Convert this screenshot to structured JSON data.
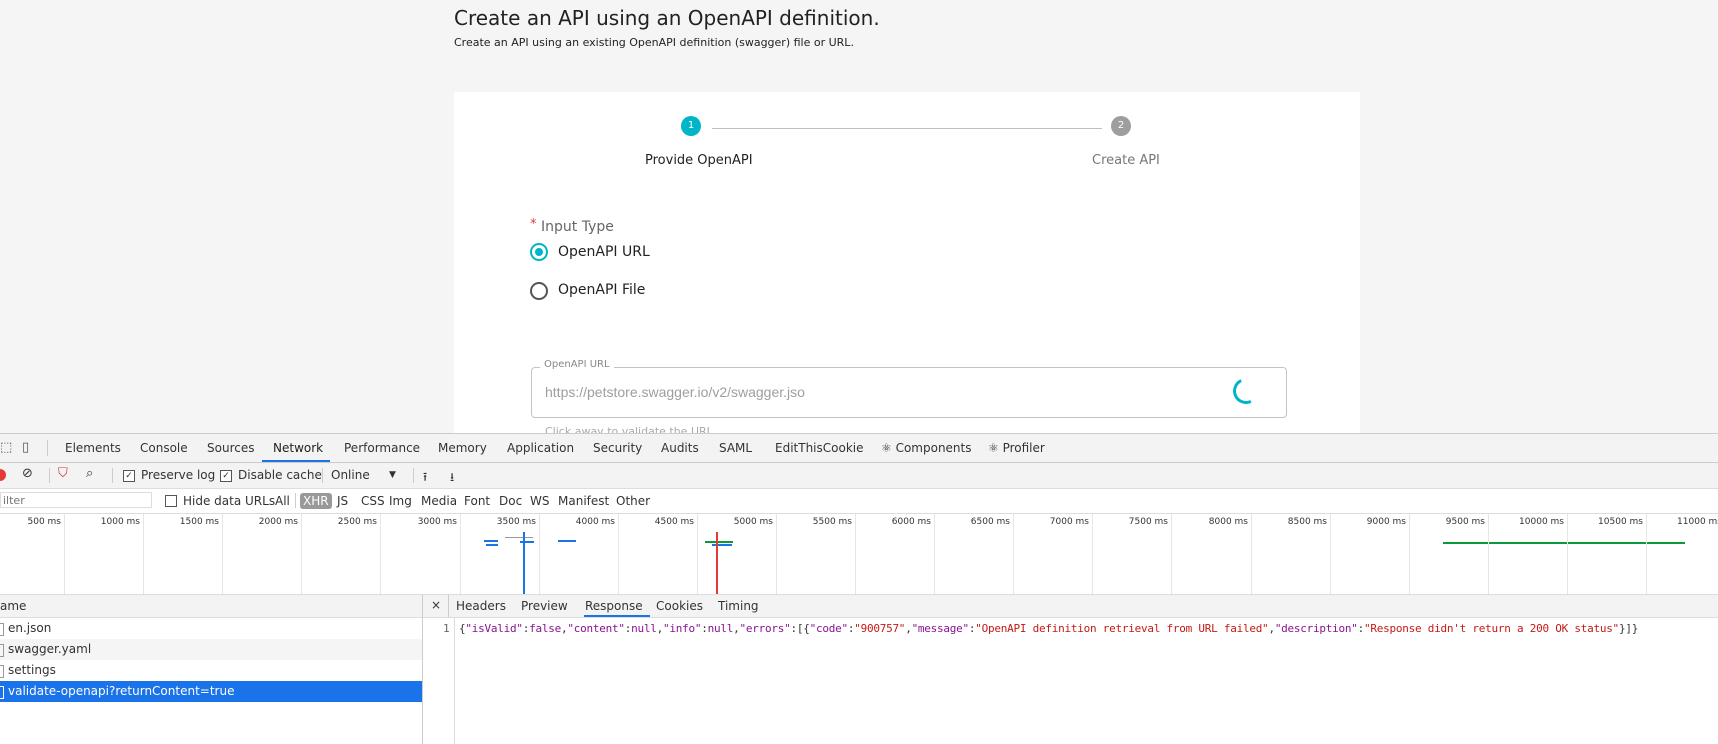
{
  "page": {
    "title": "Create an API using an OpenAPI definition.",
    "subtitle": "Create an API using an existing OpenAPI definition (swagger) file or URL."
  },
  "stepper": {
    "steps": [
      {
        "number": "1",
        "label": "Provide OpenAPI",
        "active": true
      },
      {
        "number": "2",
        "label": "Create API",
        "active": false
      }
    ],
    "colors": {
      "active": "#00b5c8",
      "inactive": "#9e9e9e"
    }
  },
  "form": {
    "required_mark": "*",
    "input_type_label": "Input Type",
    "options": [
      {
        "label": "OpenAPI URL",
        "checked": true
      },
      {
        "label": "OpenAPI File",
        "checked": false
      }
    ],
    "url_field": {
      "legend": "OpenAPI URL",
      "placeholder": "https://petstore.swagger.io/v2/swagger.jso",
      "helper": "Click away to validate the URL"
    }
  },
  "devtools": {
    "tabs": [
      "Elements",
      "Console",
      "Sources",
      "Network",
      "Performance",
      "Memory",
      "Application",
      "Security",
      "Audits",
      "SAML",
      "EditThisCookie",
      "⚛ Components",
      "⚛ Profiler"
    ],
    "active_tab": "Network",
    "toolbar": {
      "preserve_log": "Preserve log",
      "disable_cache": "Disable cache",
      "throttling": "Online"
    },
    "filter": {
      "placeholder": "ilter",
      "hide_data_urls": "Hide data URLs",
      "types": [
        "All",
        "XHR",
        "JS",
        "CSS",
        "Img",
        "Media",
        "Font",
        "Doc",
        "WS",
        "Manifest",
        "Other"
      ],
      "active_type": "XHR"
    },
    "timeline_ticks": [
      "500 ms",
      "1000 ms",
      "1500 ms",
      "2000 ms",
      "2500 ms",
      "3000 ms",
      "3500 ms",
      "4000 ms",
      "4500 ms",
      "5000 ms",
      "5500 ms",
      "6000 ms",
      "6500 ms",
      "7000 ms",
      "7500 ms",
      "8000 ms",
      "8500 ms",
      "9000 ms",
      "9500 ms",
      "10000 ms",
      "10500 ms",
      "11000 ms"
    ],
    "requests_header": "ame",
    "requests": [
      {
        "name": "en.json",
        "selected": false
      },
      {
        "name": "swagger.yaml",
        "selected": false
      },
      {
        "name": "settings",
        "selected": false
      },
      {
        "name": "validate-openapi?returnContent=true",
        "selected": true
      }
    ],
    "detail_tabs": [
      "Headers",
      "Preview",
      "Response",
      "Cookies",
      "Timing"
    ],
    "active_detail_tab": "Response",
    "close_label": "×",
    "response": {
      "line_number": "1",
      "text": "{\"isValid\":false,\"content\":null,\"info\":null,\"errors\":[{\"code\":\"900757\",\"message\":\"OpenAPI definition retrieval from URL failed\",\"description\":\"Response didn't return a 200 OK status\"}]}"
    }
  }
}
